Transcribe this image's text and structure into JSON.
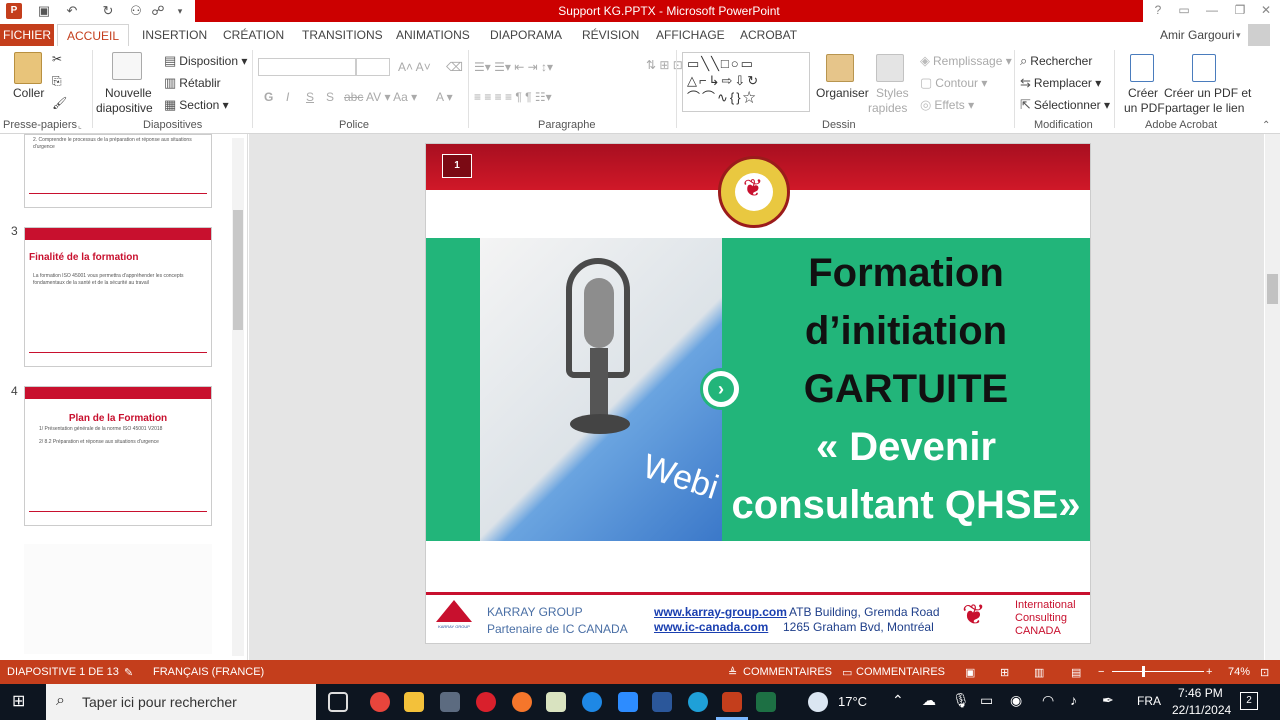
{
  "titlebar": {
    "title": "Support KG.PPTX - Microsoft PowerPoint",
    "user": "Amir Gargouri",
    "help": "?"
  },
  "tabs": [
    "FICHIER",
    "ACCUEIL",
    "INSERTION",
    "CRÉATION",
    "TRANSITIONS",
    "ANIMATIONS",
    "DIAPORAMA",
    "RÉVISION",
    "AFFICHAGE",
    "ACROBAT"
  ],
  "ribbon": {
    "clipboard": {
      "paste": "Coller",
      "label": "Presse-papiers"
    },
    "slides": {
      "new": "Nouvelle",
      "new2": "diapositive",
      "layout": "Disposition",
      "reset": "Rétablir",
      "section": "Section",
      "label": "Diapositives"
    },
    "font": {
      "label": "Police",
      "bold": "G",
      "italic": "I",
      "underline": "S",
      "shadow": "S",
      "strike": "abc"
    },
    "paragraph": {
      "label": "Paragraphe"
    },
    "drawing": {
      "arrange": "Organiser",
      "styles": "Styles",
      "styles2": "rapides",
      "fill": "Remplissage",
      "outline": "Contour",
      "effects": "Effets",
      "label": "Dessin"
    },
    "editing": {
      "find": "Rechercher",
      "replace": "Remplacer",
      "select": "Sélectionner",
      "label": "Modification"
    },
    "acrobat": {
      "create": "Créer",
      "create2": "un PDF",
      "share": "Créer un PDF et",
      "share2": "partager le lien",
      "label": "Adobe Acrobat"
    }
  },
  "thumbs": [
    {
      "num": "3",
      "title": "Finalité de la formation",
      "body": "La formation ISO 45001 vous permettra d'appréhender les concepts fondamentaux de la santé et de la sécurité au travail"
    },
    {
      "num": "4",
      "title": "Plan de la Formation",
      "line1": "1/ Présentation générale de la norme ISO 45001 V2018",
      "line2": "2/ 8.2 Préparation et réponse aux situations d'urgence"
    }
  ],
  "thumb_top_text": "2. Comprendre le processus de la préparation et réponse aux situations d'urgence",
  "slide": {
    "number": "1",
    "title1": "Formation",
    "title2": "d’initiation",
    "title3": "GARTUITE",
    "title4": "« Devenir",
    "title5": "consultant QHSE»",
    "image_text": "Webi",
    "footer": {
      "company": "KARRAY GROUP",
      "partner": "Partenaire de IC CANADA",
      "url1": "www.karray-group.com",
      "url2": "www.ic-canada.com",
      "addr1": "ATB Building, Gremda Road",
      "addr2": "1265 Graham Bvd, Montréal",
      "ic1": "International",
      "ic2": "Consulting",
      "ic3": "CANADA",
      "logo_small": "KARRAY GROUP"
    }
  },
  "status": {
    "slide": "DIAPOSITIVE 1 DE 13",
    "lang": "FRANÇAIS (FRANCE)",
    "notes": "COMMENTAIRES",
    "comments": "COMMENTAIRES",
    "zoom": "74%"
  },
  "taskbar": {
    "search": "Taper ici pour rechercher",
    "temp": "17°C",
    "lang": "FRA",
    "time": "7:46 PM",
    "date": "22/11/2024",
    "notif": "2"
  },
  "colors": {
    "accent": "#c43e1c",
    "slide_red": "#c8102e",
    "slide_green": "#22b57a"
  }
}
